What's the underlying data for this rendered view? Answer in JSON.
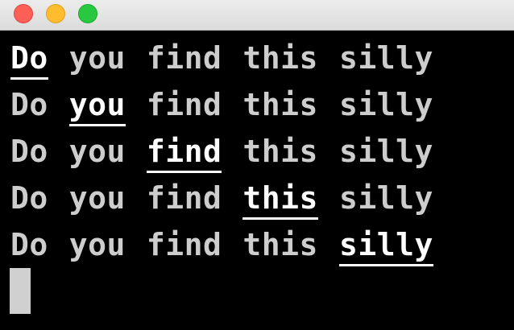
{
  "window": {
    "controls": [
      {
        "name": "close",
        "color": "#fe5f57",
        "border": "#e0443e"
      },
      {
        "name": "minimize",
        "color": "#febc2e",
        "border": "#dea123"
      },
      {
        "name": "zoom",
        "color": "#28c840",
        "border": "#1aab29"
      }
    ]
  },
  "terminal": {
    "lines": [
      {
        "words": [
          "Do",
          "you",
          "find",
          "this",
          "silly"
        ],
        "highlighted_index": 0
      },
      {
        "words": [
          "Do",
          "you",
          "find",
          "this",
          "silly"
        ],
        "highlighted_index": 1
      },
      {
        "words": [
          "Do",
          "you",
          "find",
          "this",
          "silly"
        ],
        "highlighted_index": 2
      },
      {
        "words": [
          "Do",
          "you",
          "find",
          "this",
          "silly"
        ],
        "highlighted_index": 3
      },
      {
        "words": [
          "Do",
          "you",
          "find",
          "this",
          "silly"
        ],
        "highlighted_index": 4
      }
    ],
    "colors": {
      "background": "#000000",
      "text": "#cdcdcd",
      "highlight": "#ffffff",
      "cursor": "#d0d0d0"
    }
  }
}
